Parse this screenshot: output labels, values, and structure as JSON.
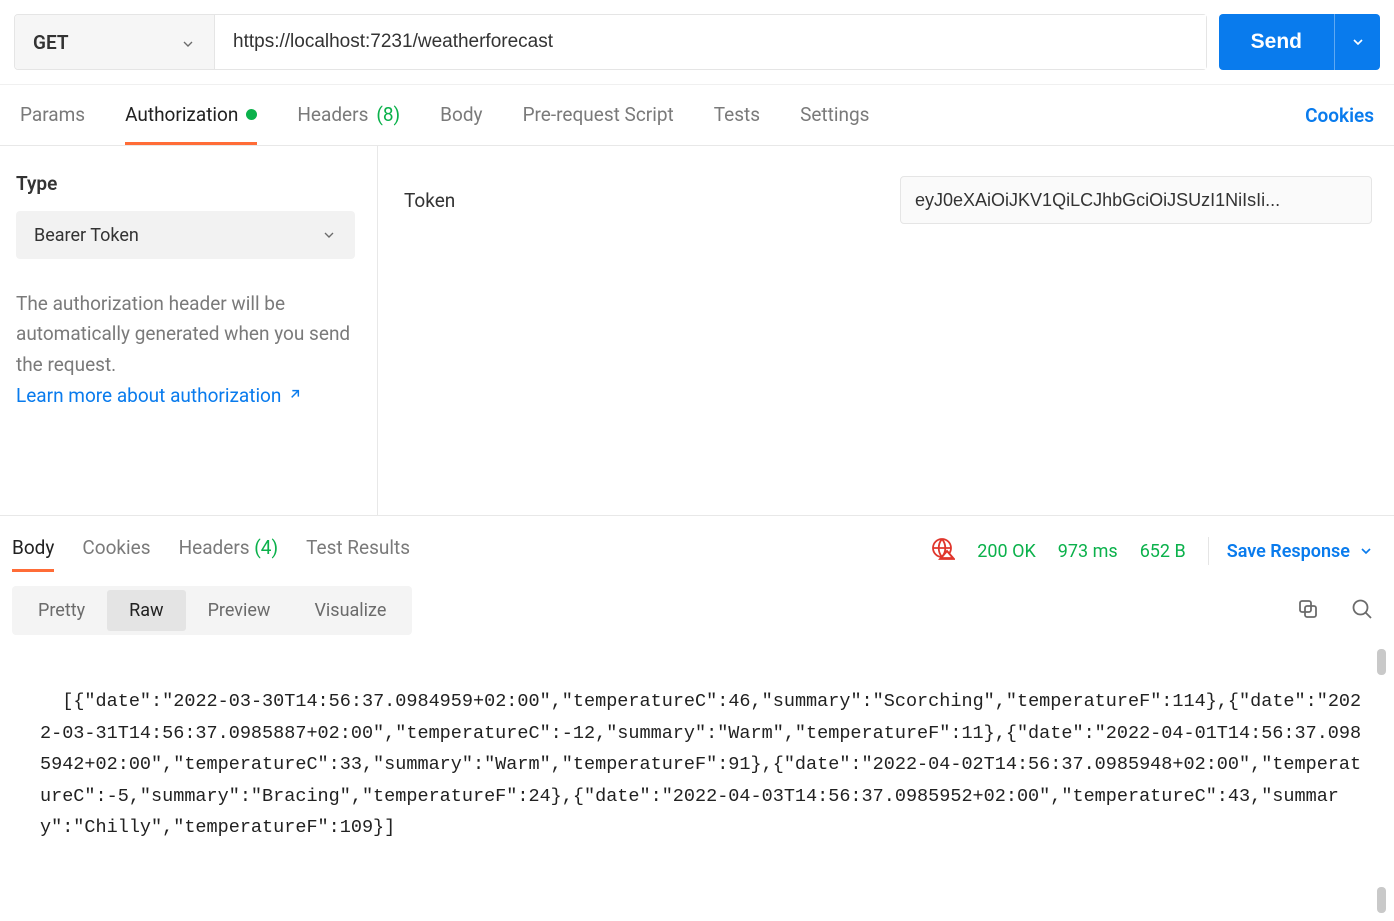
{
  "request": {
    "method": "GET",
    "url": "https://localhost:7231/weatherforecast",
    "send_label": "Send"
  },
  "tabs": {
    "params": "Params",
    "authorization": "Authorization",
    "headers": "Headers",
    "headers_count": "(8)",
    "body": "Body",
    "prerequest": "Pre-request Script",
    "tests": "Tests",
    "settings": "Settings",
    "cookies": "Cookies"
  },
  "auth": {
    "type_label": "Type",
    "type_value": "Bearer Token",
    "description": "The authorization header will be automatically generated when you send the request.",
    "learn_more": "Learn more about authorization",
    "token_label": "Token",
    "token_value": "eyJ0eXAiOiJKV1QiLCJhbGciOiJSUzI1NiIsIi..."
  },
  "response": {
    "tabs": {
      "body": "Body",
      "cookies": "Cookies",
      "headers": "Headers",
      "headers_count": "(4)",
      "test_results": "Test Results"
    },
    "status": "200 OK",
    "time": "973 ms",
    "size": "652 B",
    "save_label": "Save Response",
    "format_tabs": {
      "pretty": "Pretty",
      "raw": "Raw",
      "preview": "Preview",
      "visualize": "Visualize"
    },
    "body_text": "[{\"date\":\"2022-03-30T14:56:37.0984959+02:00\",\"temperatureC\":46,\"summary\":\"Scorching\",\"temperatureF\":114},{\"date\":\"2022-03-31T14:56:37.0985887+02:00\",\"temperatureC\":-12,\"summary\":\"Warm\",\"temperatureF\":11},{\"date\":\"2022-04-01T14:56:37.0985942+02:00\",\"temperatureC\":33,\"summary\":\"Warm\",\"temperatureF\":91},{\"date\":\"2022-04-02T14:56:37.0985948+02:00\",\"temperatureC\":-5,\"summary\":\"Bracing\",\"temperatureF\":24},{\"date\":\"2022-04-03T14:56:37.0985952+02:00\",\"temperatureC\":43,\"summary\":\"Chilly\",\"temperatureF\":109}]"
  }
}
